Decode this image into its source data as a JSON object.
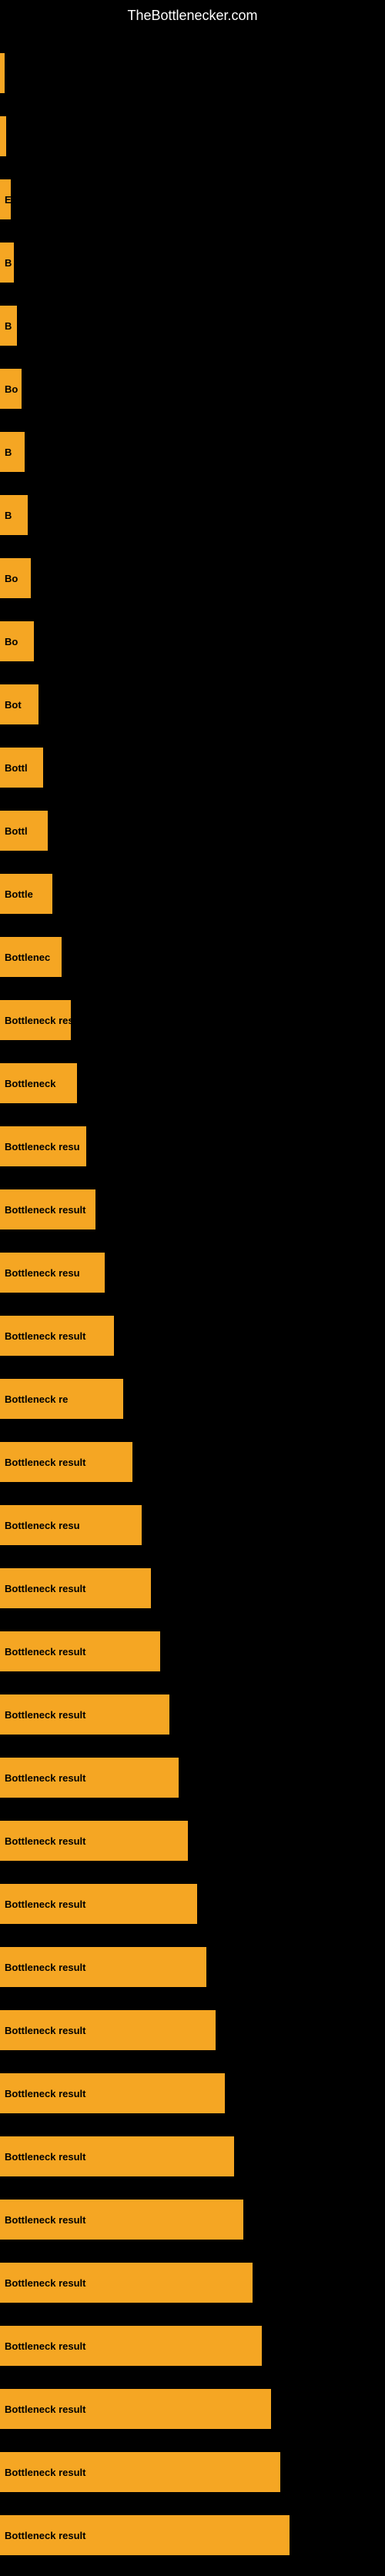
{
  "site": {
    "title": "TheBottlenecker.com"
  },
  "bars": [
    {
      "id": 1,
      "class": "bar-1",
      "label": ""
    },
    {
      "id": 2,
      "class": "bar-2",
      "label": ""
    },
    {
      "id": 3,
      "class": "bar-3",
      "label": "E"
    },
    {
      "id": 4,
      "class": "bar-4",
      "label": "B"
    },
    {
      "id": 5,
      "class": "bar-5",
      "label": "B"
    },
    {
      "id": 6,
      "class": "bar-6",
      "label": "Bo"
    },
    {
      "id": 7,
      "class": "bar-7",
      "label": "B"
    },
    {
      "id": 8,
      "class": "bar-8",
      "label": "B"
    },
    {
      "id": 9,
      "class": "bar-9",
      "label": "Bo"
    },
    {
      "id": 10,
      "class": "bar-10",
      "label": "Bo"
    },
    {
      "id": 11,
      "class": "bar-11",
      "label": "Bot"
    },
    {
      "id": 12,
      "class": "bar-12",
      "label": "Bottl"
    },
    {
      "id": 13,
      "class": "bar-13",
      "label": "Bottl"
    },
    {
      "id": 14,
      "class": "bar-14",
      "label": "Bottle"
    },
    {
      "id": 15,
      "class": "bar-15",
      "label": "Bottlenec"
    },
    {
      "id": 16,
      "class": "bar-16",
      "label": "Bottleneck res"
    },
    {
      "id": 17,
      "class": "bar-17",
      "label": "Bottleneck"
    },
    {
      "id": 18,
      "class": "bar-18",
      "label": "Bottleneck resu"
    },
    {
      "id": 19,
      "class": "bar-19",
      "label": "Bottleneck result"
    },
    {
      "id": 20,
      "class": "bar-20",
      "label": "Bottleneck resu"
    },
    {
      "id": 21,
      "class": "bar-21",
      "label": "Bottleneck result"
    },
    {
      "id": 22,
      "class": "bar-22",
      "label": "Bottleneck re"
    },
    {
      "id": 23,
      "class": "bar-23",
      "label": "Bottleneck result"
    },
    {
      "id": 24,
      "class": "bar-24",
      "label": "Bottleneck resu"
    },
    {
      "id": 25,
      "class": "bar-25",
      "label": "Bottleneck result"
    },
    {
      "id": 26,
      "class": "bar-26",
      "label": "Bottleneck result"
    },
    {
      "id": 27,
      "class": "bar-27",
      "label": "Bottleneck result"
    },
    {
      "id": 28,
      "class": "bar-28",
      "label": "Bottleneck result"
    },
    {
      "id": 29,
      "class": "bar-29",
      "label": "Bottleneck result"
    },
    {
      "id": 30,
      "class": "bar-30",
      "label": "Bottleneck result"
    },
    {
      "id": 31,
      "class": "bar-31",
      "label": "Bottleneck result"
    },
    {
      "id": 32,
      "class": "bar-32",
      "label": "Bottleneck result"
    },
    {
      "id": 33,
      "class": "bar-33",
      "label": "Bottleneck result"
    },
    {
      "id": 34,
      "class": "bar-34",
      "label": "Bottleneck result"
    },
    {
      "id": 35,
      "class": "bar-35",
      "label": "Bottleneck result"
    },
    {
      "id": 36,
      "class": "bar-36",
      "label": "Bottleneck result"
    },
    {
      "id": 37,
      "class": "bar-37",
      "label": "Bottleneck result"
    },
    {
      "id": 38,
      "class": "bar-38",
      "label": "Bottleneck result"
    },
    {
      "id": 39,
      "class": "bar-39",
      "label": "Bottleneck result"
    },
    {
      "id": 40,
      "class": "bar-40",
      "label": "Bottleneck result"
    }
  ]
}
